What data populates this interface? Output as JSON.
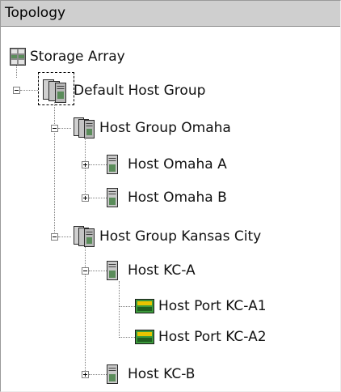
{
  "panel": {
    "title": "Topology"
  },
  "tree": {
    "storage_array": "Storage Array",
    "default_host_group": "Default Host Group",
    "group_omaha": "Host Group Omaha",
    "host_omaha_a": "Host Omaha A",
    "host_omaha_b": "Host Omaha B",
    "group_kansas_city": "Host Group Kansas City",
    "host_kc_a": "Host KC-A",
    "port_kc_a1": "Host Port KC-A1",
    "port_kc_a2": "Host Port KC-A2",
    "host_kc_b": "Host KC-B"
  },
  "icons": {
    "storage_array": "storage-array-icon",
    "host_group": "host-group-icon",
    "host": "host-icon",
    "host_port": "host-port-icon"
  },
  "colors": {
    "header_bg": "#cfcfcf",
    "port_green": "#3c9a3c",
    "port_yellow": "#e8c400"
  }
}
